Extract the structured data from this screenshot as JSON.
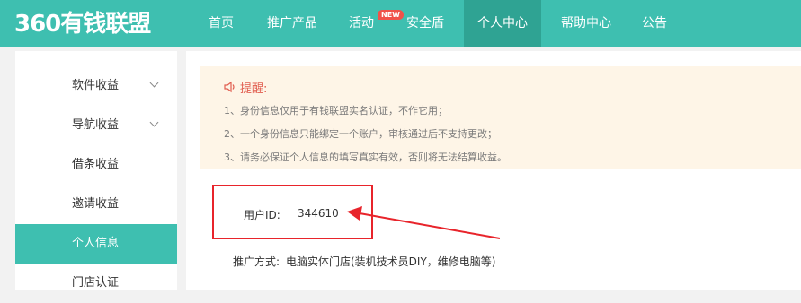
{
  "header": {
    "logo_text": "360有钱联盟",
    "nav": [
      {
        "label": "首页"
      },
      {
        "label": "推广产品"
      },
      {
        "label": "活动"
      },
      {
        "label": "安全盾"
      },
      {
        "label": "个人中心"
      },
      {
        "label": "帮助中心"
      },
      {
        "label": "公告"
      }
    ],
    "new_badge": "NEW",
    "brand_color": "#3ebfb0"
  },
  "sidebar": {
    "items": [
      {
        "label": "软件收益",
        "expandable": true
      },
      {
        "label": "导航收益",
        "expandable": true
      },
      {
        "label": "借条收益"
      },
      {
        "label": "邀请收益"
      },
      {
        "label": "个人信息",
        "active": true
      },
      {
        "label": "门店认证"
      }
    ]
  },
  "notice": {
    "icon": "speaker-icon",
    "title": "提醒:",
    "lines": [
      "1、身份信息仅用于有钱联盟实名认证，不作它用；",
      "2、一个身份信息只能绑定一个账户，审核通过后不支持更改；",
      "3、请务必保证个人信息的填写真实有效，否则将无法结算收益。"
    ]
  },
  "profile": {
    "user_id_label": "用户ID:",
    "user_id_value": "344610",
    "promo_label": "推广方式:",
    "promo_value": "电脑实体门店(装机技术员DIY，维修电脑等)"
  },
  "annotation": {
    "color": "#e8242b"
  }
}
